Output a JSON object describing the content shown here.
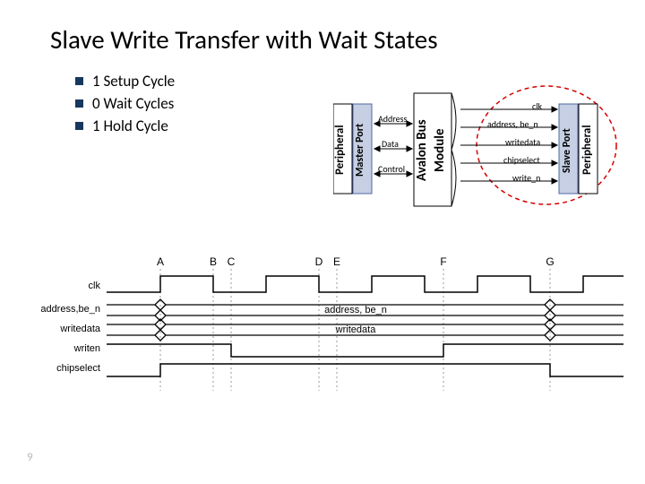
{
  "title": "Slave Write Transfer with Wait States",
  "bullets": [
    "1 Setup Cycle",
    "0 Wait Cycles",
    "1 Hold Cycle"
  ],
  "bus": {
    "peripheral_left": "Peripheral",
    "master_port": "Master Port",
    "avalon_bus": "Avalon Bus",
    "module": "Module",
    "slave_port": "Slave Port",
    "peripheral_right": "Peripheral",
    "mp_sig1": "Address",
    "mp_sig2": "Data",
    "mp_sig3": "Control",
    "sp_sig0": "clk",
    "sp_sig1": "address, be_n",
    "sp_sig2": "writedata",
    "sp_sig3": "chipselect",
    "sp_sig4": "write_n"
  },
  "timing": {
    "markers": [
      "A",
      "B",
      "C",
      "D",
      "E",
      "F",
      "G"
    ],
    "rows": [
      {
        "label": "clk"
      },
      {
        "label": "address,be_n",
        "mid": "address, be_n"
      },
      {
        "label": "writedata",
        "mid": "writedata"
      },
      {
        "label": "writen"
      },
      {
        "label": "chipselect"
      }
    ]
  },
  "page_number": "9"
}
